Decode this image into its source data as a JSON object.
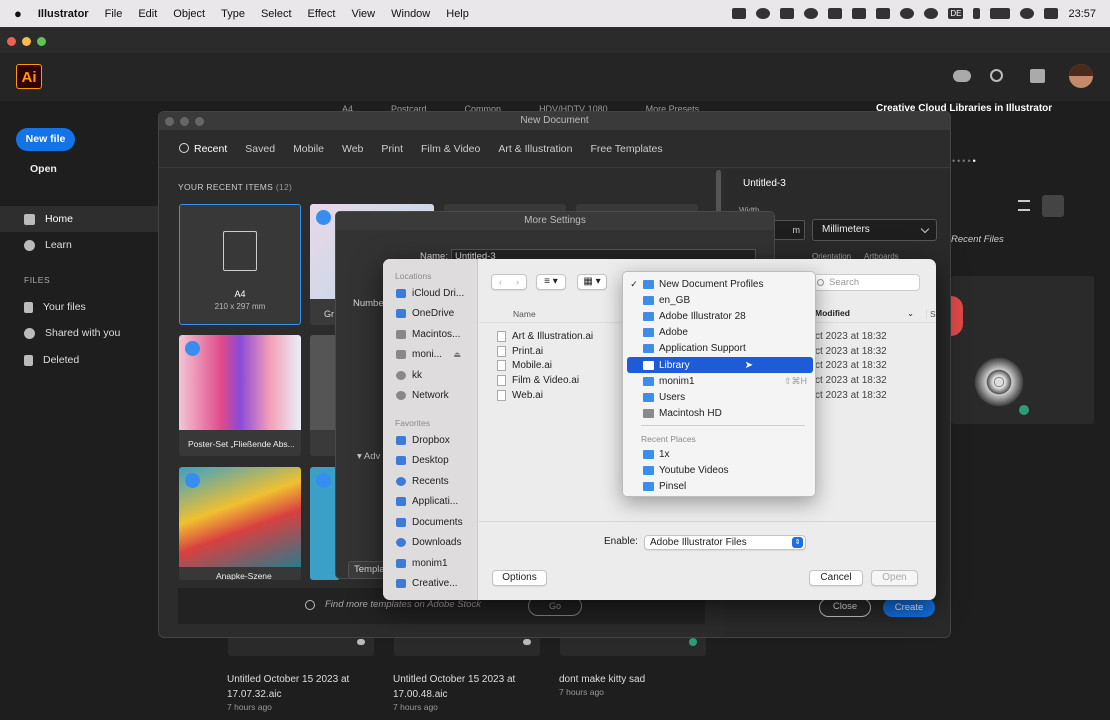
{
  "menubar": {
    "apple": "",
    "items": [
      "Illustrator",
      "File",
      "Edit",
      "Object",
      "Type",
      "Select",
      "Effect",
      "View",
      "Window",
      "Help"
    ],
    "clock": "23:57",
    "input_source": "DE"
  },
  "app": {
    "logo": "Ai",
    "new_file": "New file",
    "open": "Open"
  },
  "nav": {
    "home": "Home",
    "learn": "Learn",
    "files_header": "FILES",
    "your_files": "Your files",
    "shared": "Shared with you",
    "deleted": "Deleted"
  },
  "home_header": {
    "bg_tabs": [
      "A4",
      "Postcard",
      "Common",
      "HDV/HDTV 1080",
      "More Presets"
    ],
    "cc_libraries": "Creative Cloud Libraries in Illustrator",
    "recent_files": "Recent Files"
  },
  "recent_files": [
    {
      "name": "Untitled October 15 2023 at 17.07.32.aic",
      "time": "7 hours ago"
    },
    {
      "name": "Untitled October 15 2023 at 17.00.48.aic",
      "time": "7 hours ago"
    },
    {
      "name": "dont make kitty sad",
      "time": "7 hours ago"
    }
  ],
  "new_document": {
    "title": "New Document",
    "tabs": [
      "Recent",
      "Saved",
      "Mobile",
      "Web",
      "Print",
      "Film & Video",
      "Art & Illustration",
      "Free Templates"
    ],
    "recent_header": "YOUR RECENT ITEMS",
    "recent_count": "(12)",
    "preset_a4": {
      "name": "A4",
      "size": "210 x 297 mm"
    },
    "poster_name": "Poster-Set „Fließende Abs...",
    "anapke_name": "Anapke-Szene",
    "partial_gr": "Gr",
    "doc_name": "Untitled-3",
    "width_label": "Width",
    "units": "Millimeters",
    "orientation_label": "Orientation",
    "artboards_label": "Artboards",
    "find_templates_placeholder": "Find more templates on Adobe Stock",
    "go": "Go",
    "close": "Close",
    "create": "Create"
  },
  "more_settings": {
    "title": "More Settings",
    "name_label": "Name:",
    "name_value": "Untitled-3",
    "number_label": "Numbe",
    "advanced_label": "Adv",
    "template_label": "Templa"
  },
  "finder": {
    "locations_header": "Locations",
    "locations": [
      "iCloud Dri...",
      "OneDrive",
      "Macintos...",
      "moni...",
      "kk",
      "Network"
    ],
    "favorites_header": "Favorites",
    "favorites": [
      "Dropbox",
      "Desktop",
      "Recents",
      "Applicati...",
      "Documents",
      "Downloads",
      "monim1",
      "Creative..."
    ],
    "col_name": "Name",
    "col_modified": "Modified",
    "col_size": "Si",
    "search_placeholder": "Search",
    "files": [
      {
        "name": "Art & Illustration.ai",
        "modified": "ct 2023 at 18:32"
      },
      {
        "name": "Print.ai",
        "modified": "ct 2023 at 18:32"
      },
      {
        "name": "Mobile.ai",
        "modified": "ct 2023 at 18:32"
      },
      {
        "name": "Film & Video.ai",
        "modified": "ct 2023 at 18:32"
      },
      {
        "name": "Web.ai",
        "modified": "ct 2023 at 18:32"
      }
    ],
    "enable_label": "Enable:",
    "enable_value": "Adobe Illustrator Files",
    "options": "Options",
    "cancel": "Cancel",
    "open": "Open"
  },
  "path_dropdown": {
    "items": [
      {
        "label": "New Document Profiles",
        "checked": true
      },
      {
        "label": "en_GB"
      },
      {
        "label": "Adobe Illustrator 28"
      },
      {
        "label": "Adobe"
      },
      {
        "label": "Application Support"
      },
      {
        "label": "Library",
        "selected": true
      },
      {
        "label": "monim1",
        "shortcut": "⇧⌘H"
      },
      {
        "label": "Users"
      },
      {
        "label": "Macintosh HD"
      }
    ],
    "recent_places_header": "Recent Places",
    "recent_places": [
      "1x",
      "Youtube Videos",
      "Pinsel"
    ]
  }
}
